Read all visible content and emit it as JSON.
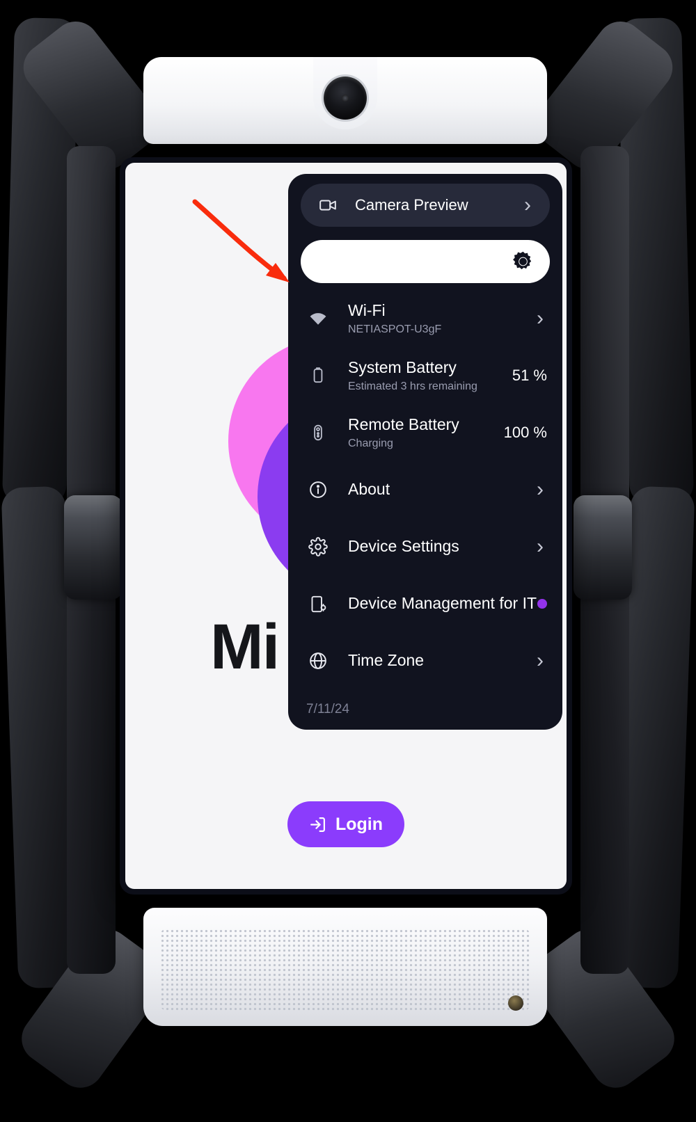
{
  "device": {
    "name": "telepresence-robot",
    "screen_background": "#f5f5f7",
    "panel_background": "#11131f",
    "accent_purple": "#8b3cfc",
    "accent_pink": "#f877ef",
    "notification_dot_color": "#9333ea"
  },
  "screen": {
    "brand_word": "Mi",
    "login": {
      "label": "Login",
      "icon": "login-icon"
    }
  },
  "panel": {
    "camera_preview": {
      "label": "Camera Preview",
      "icon": "video-camera-icon",
      "chevron": "›"
    },
    "brightness": {
      "icon": "brightness-sun-icon",
      "value": 100
    },
    "items": [
      {
        "id": "wifi",
        "icon": "wifi-icon",
        "title": "Wi-Fi",
        "subtitle": "NETIASPOT-U3gF",
        "value": "",
        "accessory": "chevron",
        "chevron": "›"
      },
      {
        "id": "system-battery",
        "icon": "battery-icon",
        "title": "System Battery",
        "subtitle": "Estimated 3 hrs remaining",
        "value": "51 %",
        "accessory": "value"
      },
      {
        "id": "remote-battery",
        "icon": "remote-battery-icon",
        "title": "Remote Battery",
        "subtitle": "Charging",
        "value": "100 %",
        "accessory": "value"
      },
      {
        "id": "about",
        "icon": "info-circle-icon",
        "title": "About",
        "subtitle": "",
        "value": "",
        "accessory": "chevron",
        "chevron": "›"
      },
      {
        "id": "device-settings",
        "icon": "gear-icon",
        "title": "Device Settings",
        "subtitle": "",
        "value": "",
        "accessory": "chevron",
        "chevron": "›"
      },
      {
        "id": "device-management-for-it",
        "icon": "device-management-icon",
        "title": "Device Management for IT",
        "subtitle": "",
        "value": "",
        "accessory": "dot"
      },
      {
        "id": "time-zone",
        "icon": "globe-icon",
        "title": "Time Zone",
        "subtitle": "",
        "value": "",
        "accessory": "chevron",
        "chevron": "›"
      }
    ],
    "date": "7/11/24"
  },
  "annotation": {
    "arrow_color": "#f92c0d",
    "points_to": "wifi"
  }
}
